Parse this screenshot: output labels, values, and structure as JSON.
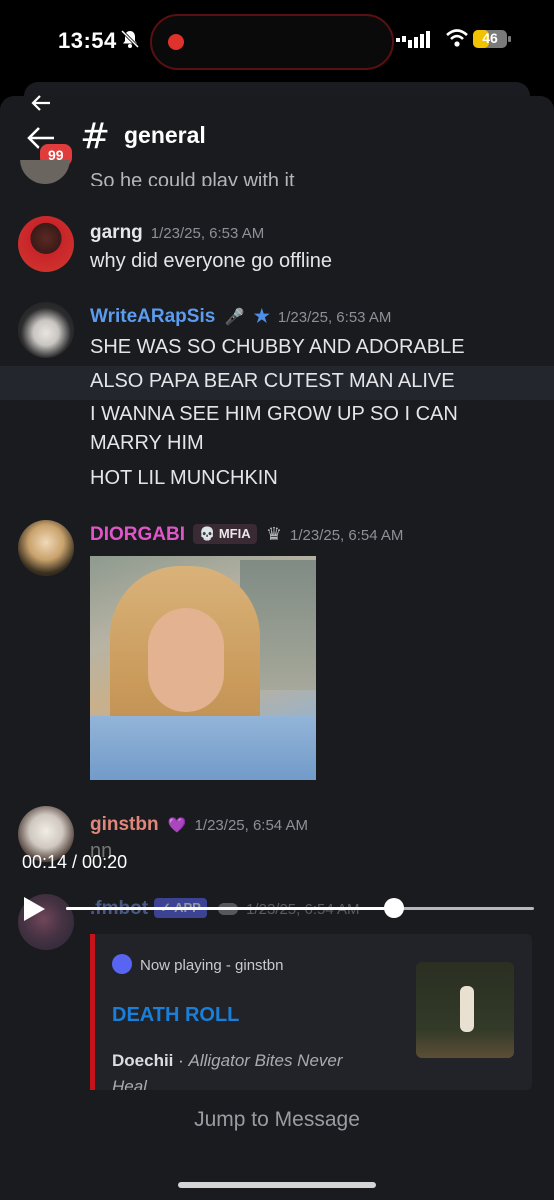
{
  "status_bar": {
    "time": "13:54",
    "battery": "46"
  },
  "header": {
    "channel_name": "general",
    "unread_count": "99"
  },
  "cut_off_message": "So he could play with it",
  "messages": [
    {
      "author": "garng",
      "author_color": "#e6e7ea",
      "timestamp": "1/23/25, 6:53 AM",
      "lines": [
        "why did everyone go offline"
      ]
    },
    {
      "author": "WriteARapSis",
      "author_color": "#5b9cf0",
      "badges": [
        "🎤",
        "★"
      ],
      "timestamp": "1/23/25, 6:53 AM",
      "lines": [
        "SHE WAS SO CHUBBY AND ADORABLE",
        "ALSO PAPA BEAR CUTEST MAN ALIVE",
        "I WANNA SEE HIM GROW UP SO I CAN",
        "MARRY HIM",
        "HOT LIL MUNCHKIN"
      ]
    },
    {
      "author": "DIORGABI",
      "author_color": "#e056c8",
      "tag": "MFIA",
      "tag_icon": "💀",
      "crown": "♛",
      "timestamp": "1/23/25, 6:54 AM"
    },
    {
      "author": "ginstbn",
      "author_color": "#e0877a",
      "badge": "💜",
      "timestamp": "1/23/25, 6:54 AM",
      "lines": [
        "nn"
      ]
    },
    {
      "author": ".fmbot",
      "author_color": "#6f8fd8",
      "tag": "✓ APP",
      "timestamp": "1/23/25, 6:54 AM"
    }
  ],
  "video": {
    "time_display": "00:14 / 00:20",
    "progress": 0.7
  },
  "embed": {
    "provider": "Now playing - ginstbn",
    "title": "DEATH ROLL",
    "artist": "Doechii",
    "separator": " · ",
    "album": "Alligator Bites Never Heal",
    "accent_color": "#c4131b"
  },
  "jump_to_message": "Jump to Message"
}
